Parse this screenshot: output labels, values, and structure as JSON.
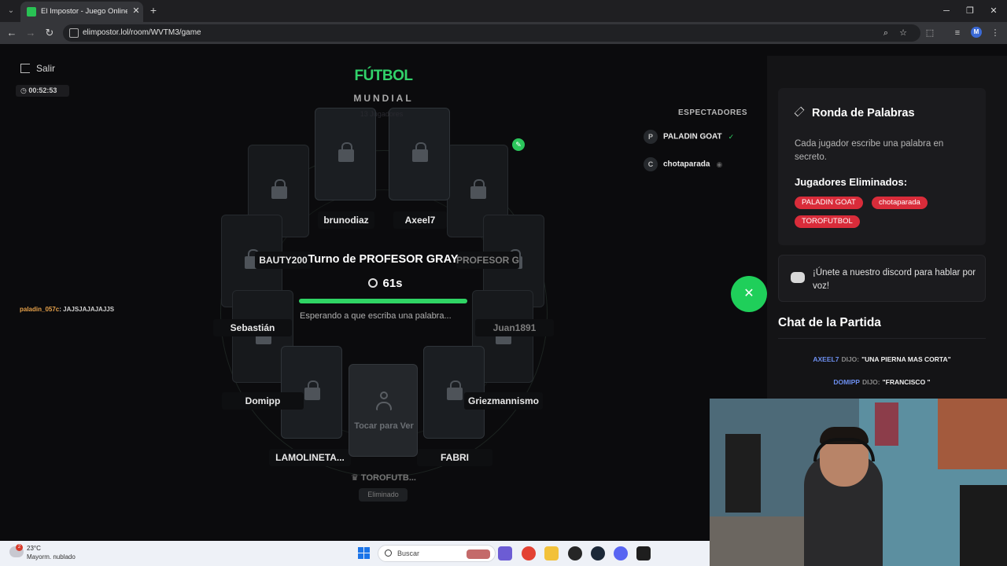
{
  "browser": {
    "tab_title": "El Impostor - Juego Online Gra",
    "url": "elimpostor.lol/room/WVTM3/game",
    "profile_initial": "M"
  },
  "header": {
    "exit_label": "Salir",
    "elapsed": "00:52:53",
    "category": "FÚTBOL",
    "subcategory": "MUNDIAL",
    "players_count": "13 Jugadores"
  },
  "side_chat": {
    "user": "paladin_057c",
    "message": ": JAJSJAJAJAJJS"
  },
  "game": {
    "players": [
      "brunodiaz",
      "Axeel7",
      "BAUTY200",
      "PROFESOR G...",
      "Sebastián",
      "Juan1891",
      "Domipp",
      "Griezmannismo",
      "LAMOLINETA...",
      "FABRI"
    ],
    "turn_text": "Turno de PROFESOR GRAY",
    "timer": "61s",
    "progress": 1.0,
    "waiting_text": "Esperando a que escriba una palabra...",
    "tap_text": "Tocar para Ver",
    "current_user": "TOROFUTB...",
    "eliminated_label": "Eliminado"
  },
  "spectators": {
    "title": "ESPECTADORES",
    "items": [
      {
        "initial": "P",
        "name": "PALADIN GOAT",
        "badge": "✓"
      },
      {
        "initial": "C",
        "name": "chotaparada",
        "badge": "◉"
      }
    ]
  },
  "round_panel": {
    "title": "Ronda de Palabras",
    "description": "Cada jugador escribe una palabra en secreto.",
    "eliminated_title": "Jugadores Eliminados:",
    "eliminated": [
      "PALADIN GOAT",
      "chotaparada",
      "TOROFUTBOL"
    ]
  },
  "discord": {
    "text": "¡Únete a nuestro discord para hablar por voz!"
  },
  "chat": {
    "title": "Chat de la Partida",
    "said_label": "DIJO:",
    "messages": [
      {
        "user": "AXEEL7",
        "text": "\"UNA PIERNA MAS CORTA\""
      },
      {
        "user": "DOMIPP",
        "text": "\"FRANCISCO \""
      }
    ]
  },
  "taskbar": {
    "temp": "23°C",
    "weather": "Mayorm. nublado",
    "weather_badge": "2",
    "search_placeholder": "Buscar"
  },
  "colors": {
    "accent_green": "#31d26a",
    "danger_red": "#d92c3a",
    "chat_user_blue": "#6d8ff0"
  }
}
